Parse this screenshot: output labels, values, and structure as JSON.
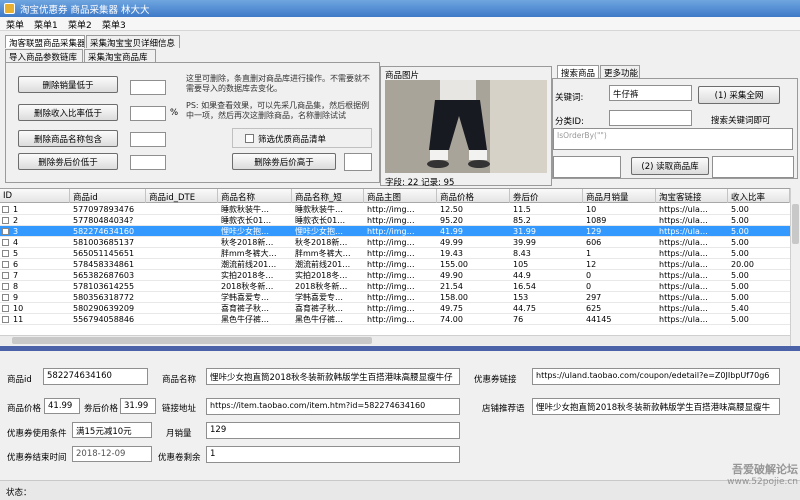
{
  "window": {
    "title": "淘宝优惠券 商品采集器   林大大"
  },
  "menu": [
    "菜单",
    "菜单1",
    "菜单2",
    "菜单3"
  ],
  "left_tabs": {
    "row1": [
      "淘客联盟商品采集器",
      "采集淘宝宝贝详细信息"
    ],
    "row2": [
      "导入商品参数链库",
      "采集淘宝商品库"
    ]
  },
  "filters": {
    "delete_sales_low": "删除销量低于",
    "delete_commission_low": "删除收入比率低于",
    "percent_sign": "%",
    "delete_name_contains": "删除商品名称包含",
    "delete_coupon_low": "删除劵后价低于",
    "delete_coupon_high": "删除劵后价高于",
    "filter_goods_check": "筛选优质商品清单",
    "hint": "这里可删除，条直删对商品库进行操作。不需要就不需要导入的数据库去变化。",
    "hint2": "PS: 如果查看效果，可以先采几商品集，然后根据例中一项，然后再次这删除商品，名称删除试试"
  },
  "image_panel": {
    "label": "商品图片",
    "caption": "字段: 22 记录: 95"
  },
  "right_tabs": [
    "搜索商品",
    "更多功能"
  ],
  "search": {
    "keyword_label": "关键词:",
    "keyword_value": "牛仔裤",
    "category_label": "分类ID:",
    "collect_all_button": "(1) 采集全网",
    "search_hint": "搜索关键词即可",
    "code_text": "IsOrderBy(\"\")",
    "read_library_button": "(2) 读取商品库"
  },
  "table": {
    "columns": [
      "ID",
      "商品id",
      "商品id_DTE",
      "商品名称",
      "商品名称_短",
      "商品主图",
      "商品价格",
      "劵后价",
      "商品月销量",
      "淘宝客链接",
      "收入比率"
    ],
    "rows": [
      [
        "1",
        "577097893476",
        "",
        "睡款秋装牛…",
        "睡款秋装牛…",
        "http://img…",
        "12.50",
        "11.5",
        "10",
        "https://ula…",
        "5.00"
      ],
      [
        "2",
        "57780484034?",
        "",
        "睡款衣长01…",
        "睡款衣长01…",
        "http://img…",
        "95.20",
        "85.2",
        "1089",
        "https://ula…",
        "5.00"
      ],
      [
        "3",
        "582274634160",
        "",
        "悝咔少女抱…",
        "悝咔少女抱…",
        "http://img…",
        "41.99",
        "31.99",
        "129",
        "https://ula…",
        "5.00"
      ],
      [
        "4",
        "581003685137",
        "",
        "秋冬2018新…",
        "秋冬2018新…",
        "http://img…",
        "49.99",
        "39.99",
        "606",
        "https://ula…",
        "5.00"
      ],
      [
        "5",
        "565051145651",
        "",
        "胖mm冬裤大…",
        "胖mm冬裤大…",
        "http://img…",
        "19.43",
        "8.43",
        "1",
        "https://ula…",
        "5.00"
      ],
      [
        "6",
        "578458334861",
        "",
        "潮流前线201…",
        "潮流前线201…",
        "http://img…",
        "155.00",
        "105",
        "12",
        "https://ula…",
        "20.00"
      ],
      [
        "7",
        "565382687603",
        "",
        "实拍2018冬…",
        "实拍2018冬…",
        "http://img…",
        "49.90",
        "44.9",
        "0",
        "https://ula…",
        "5.00"
      ],
      [
        "8",
        "578103614255",
        "",
        "2018秋冬新…",
        "2018秋冬新…",
        "http://img…",
        "21.54",
        "16.54",
        "0",
        "https://ula…",
        "5.00"
      ],
      [
        "9",
        "580356318772",
        "",
        "学韩喜爱专…",
        "学韩喜爱专…",
        "http://img…",
        "158.00",
        "153",
        "297",
        "https://ula…",
        "5.00"
      ],
      [
        "10",
        "580290639209",
        "",
        "喜育裤子秋…",
        "喜育裤子秋…",
        "http://img…",
        "49.75",
        "44.75",
        "625",
        "https://ula…",
        "5.40"
      ],
      [
        "11",
        "556794058846",
        "",
        "黑色牛仔裤…",
        "黑色牛仔裤…",
        "http://img…",
        "74.00",
        "76",
        "44145",
        "https://ula…",
        "5.00"
      ]
    ],
    "selected_index": 2
  },
  "detail": {
    "product_id_label": "商品id",
    "product_id": "582274634160",
    "product_name_label": "商品名称",
    "product_name": "悝咔少女抱直筒2018秋冬装新款韩版学生百搭港味高腰显瘦牛仔",
    "coupon_link_label": "优惠券链接",
    "coupon_link": "https://uland.taobao.com/coupon/edetail?e=Z0JIbpUf70g6",
    "price_label": "商品价格",
    "price": "41.99",
    "after_coupon_label": "劵后价格",
    "after_coupon": "31.99",
    "link_label": "链接地址",
    "link": "https://item.taobao.com/item.htm?id=582274634160",
    "promo_label": "店铺推荐语",
    "promo": "悝咔少女抱直筒2018秋冬装新款韩版学生百搭港味高腰显瘦牛",
    "coupon_condition_label": "优惠券使用条件",
    "coupon_condition": "满15元减10元",
    "monthly_sales_label": "月销量",
    "monthly_sales": "129",
    "coupon_end_label": "优惠券结束时间",
    "coupon_end": "2018-12-09",
    "coupon_remain_label": "优惠卷剩余",
    "coupon_remain": "1"
  },
  "status": {
    "label": "状态："
  },
  "watermark": {
    "line1": "吾爱破解论坛",
    "line2": "www.52pojie.cn"
  }
}
